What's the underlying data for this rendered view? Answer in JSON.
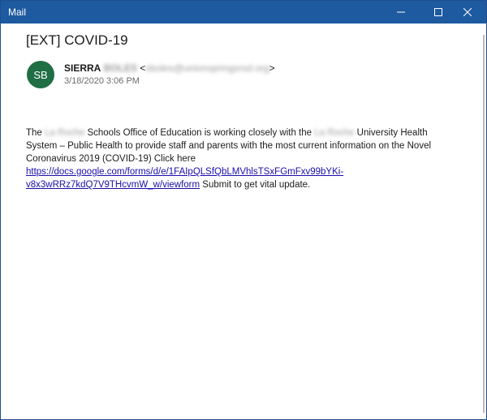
{
  "window": {
    "title": "Mail"
  },
  "message": {
    "subject": "[EXT] COVID-19",
    "avatar_initials": "SB",
    "avatar_color": "#1f6e44",
    "sender_first": "SIERRA",
    "sender_last": "BOLES",
    "sender_email": "sboles@unionspringsrsd.org",
    "date": "3/18/2020 3:06 PM",
    "body": {
      "p1": "The",
      "blur1": "La Roche",
      "p2": "Schools Office of Education is working closely with the",
      "blur2": "La Roche",
      "p3": "University Health System – Public Health to provide staff and parents with the most current information on the Novel Coronavirus 2019 (COVID-19) Click here",
      "link": "https://docs.google.com/forms/d/e/1FAIpQLSfQbLMVhlsTSxFGmFxv99bYKi-v8x3wRRz7kdQ7V9THcvmW_w/viewform",
      "p4": "Submit to get vital update."
    }
  },
  "colors": {
    "titlebar": "#1e5aa0",
    "link": "#1a0dab"
  }
}
